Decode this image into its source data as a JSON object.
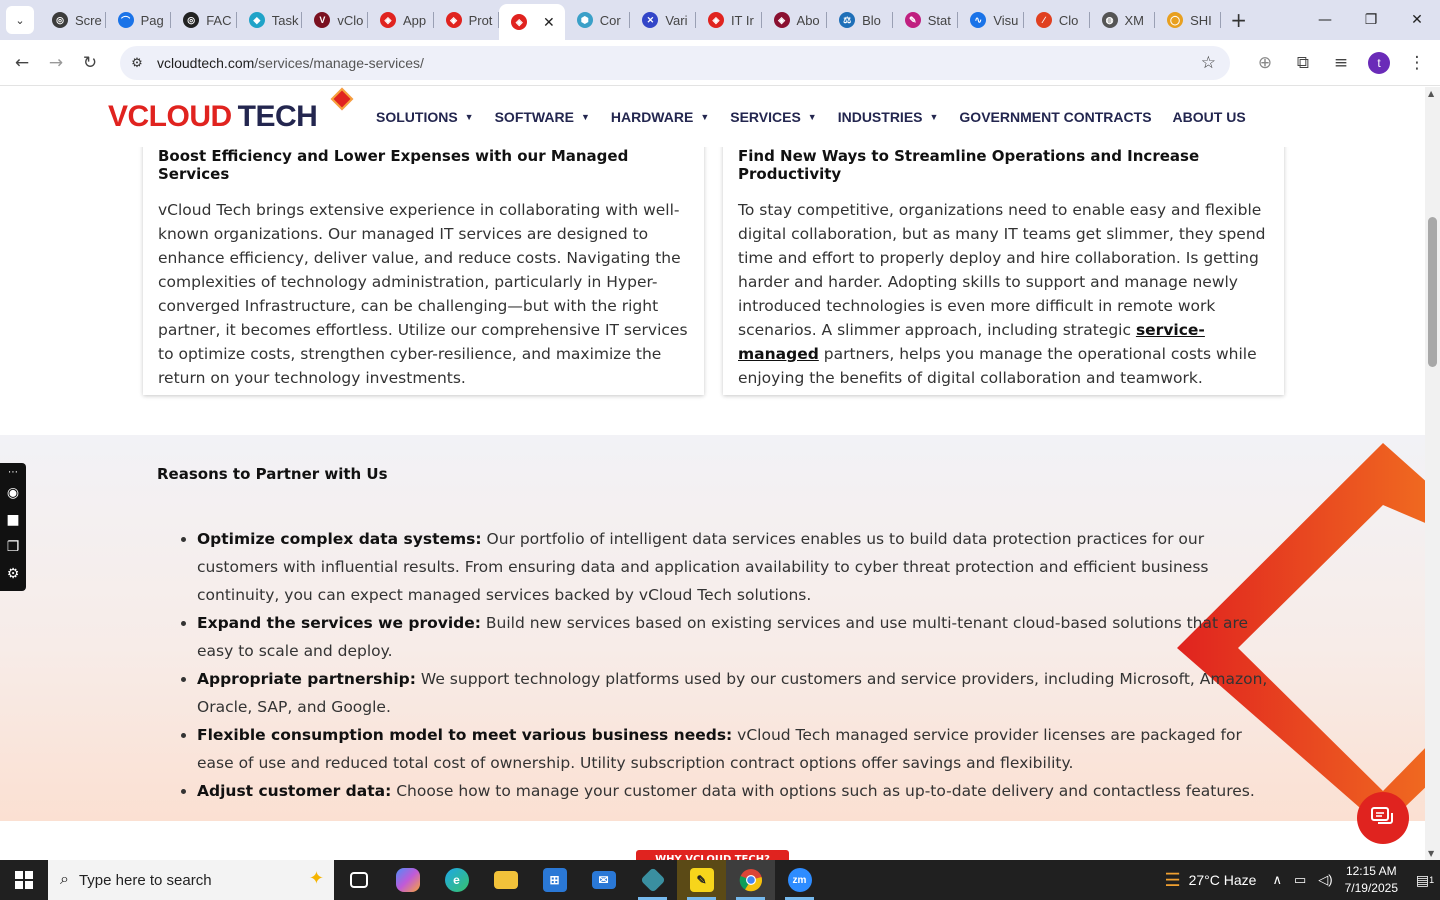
{
  "browser": {
    "tabs": [
      {
        "label": "Scre",
        "color": "#3c3c3c",
        "glyph": "◎"
      },
      {
        "label": "Pag",
        "color": "#1a73e8",
        "glyph": "⌒"
      },
      {
        "label": "FAC",
        "color": "#222222",
        "glyph": "◎"
      },
      {
        "label": "Task",
        "color": "#20a3c8",
        "glyph": "◆"
      },
      {
        "label": "vClo",
        "color": "#7a1020",
        "glyph": "V"
      },
      {
        "label": "App",
        "color": "#e0231f",
        "glyph": "◈"
      },
      {
        "label": "Prot",
        "color": "#e0231f",
        "glyph": "◈"
      },
      {
        "label": "",
        "color": "#e0231f",
        "glyph": "◈",
        "active": true
      },
      {
        "label": "Cor",
        "color": "#3aa0c8",
        "glyph": "⬢"
      },
      {
        "label": "Vari",
        "color": "#3346c8",
        "glyph": "✕"
      },
      {
        "label": "IT Ir",
        "color": "#e0231f",
        "glyph": "◈"
      },
      {
        "label": "Abo",
        "color": "#8a1030",
        "glyph": "◈"
      },
      {
        "label": "Blo",
        "color": "#1e6fb8",
        "glyph": "⚖"
      },
      {
        "label": "Stat",
        "color": "#c02080",
        "glyph": "✎"
      },
      {
        "label": "Visu",
        "color": "#1a73e8",
        "glyph": "∿"
      },
      {
        "label": "Clo",
        "color": "#e04020",
        "glyph": "∕"
      },
      {
        "label": "XM",
        "color": "#555555",
        "glyph": "◍"
      },
      {
        "label": "SHI",
        "color": "#e8a020",
        "glyph": "◯"
      }
    ],
    "new_tab": "+",
    "window_controls": {
      "minimize": "—",
      "maximize": "❐",
      "close": "✕"
    },
    "url_host": "vcloudtech.com",
    "url_path": "/services/manage-services/",
    "profile_initial": "t"
  },
  "site": {
    "logo": {
      "v": "V",
      "cloud": "CLOUD",
      "tech": "TECH"
    },
    "nav": [
      {
        "label": "SOLUTIONS",
        "dropdown": true
      },
      {
        "label": "SOFTWARE",
        "dropdown": true
      },
      {
        "label": "HARDWARE",
        "dropdown": true
      },
      {
        "label": "SERVICES",
        "dropdown": true
      },
      {
        "label": "INDUSTRIES",
        "dropdown": true
      },
      {
        "label": "GOVERNMENT CONTRACTS",
        "dropdown": false
      },
      {
        "label": "ABOUT US",
        "dropdown": false
      }
    ],
    "cards": {
      "left": {
        "title": "Boost Efficiency and Lower Expenses with our Managed Services",
        "body": "vCloud Tech brings extensive experience in collaborating with well-known organizations. Our managed IT services are designed to enhance efficiency, deliver value, and reduce costs. Navigating the complexities of technology administration, particularly in Hyper-converged Infrastructure, can be challenging—but with the right partner, it becomes effortless. Utilize our comprehensive IT services to optimize costs, strengthen cyber-resilience, and maximize the return on your technology investments."
      },
      "right": {
        "title": "Find New Ways to Streamline Operations and Increase Productivity",
        "body_before": "To stay competitive, organizations need to enable easy and flexible digital collaboration, but as many IT teams get slimmer, they spend time and effort to properly deploy and hire collaboration. Is getting harder and harder. Adopting skills to support and manage newly introduced technologies is even more difficult in remote work scenarios. A slimmer approach, including strategic ",
        "link": "service-managed",
        "body_after": " partners, helps you manage the operational costs while enjoying the benefits of digital collaboration and teamwork."
      }
    },
    "reasons": {
      "heading": "Reasons to Partner with Us",
      "items": [
        {
          "title": "Optimize complex data systems:",
          "text": " Our portfolio of intelligent data services enables us to build data protection practices for our customers with influential results. From ensuring data and application availability to cyber threat protection and efficient business continuity, you can expect managed services backed by vCloud Tech solutions."
        },
        {
          "title": "Expand the services we provide:",
          "text": " Build new services based on existing services and use multi-tenant cloud-based solutions that are easy to scale and deploy."
        },
        {
          "title": "Appropriate partnership:",
          "text": " We support technology platforms used by our customers and service providers, including Microsoft, Amazon, Oracle, SAP, and Google."
        },
        {
          "title": "Flexible consumption model to meet various business needs:",
          "text": " vCloud Tech managed service provider licenses are packaged for ease of use and reduced total cost of ownership. Utility subscription contract options offer savings and flexibility."
        },
        {
          "title": "Adjust customer data:",
          "text": " Choose how to manage your customer data with options such as up-to-date delivery and contactless features."
        }
      ]
    },
    "why_badge": "WHY VCLOUD TECH?",
    "colors": {
      "brand_red": "#e0231f",
      "brand_navy": "#23264f",
      "brand_orange": "#f6a23c"
    }
  },
  "taskbar": {
    "search_placeholder": "Type here to search",
    "weather": "27°C  Haze",
    "time": "12:15 AM",
    "date": "7/19/2025",
    "notification_count": "1"
  }
}
